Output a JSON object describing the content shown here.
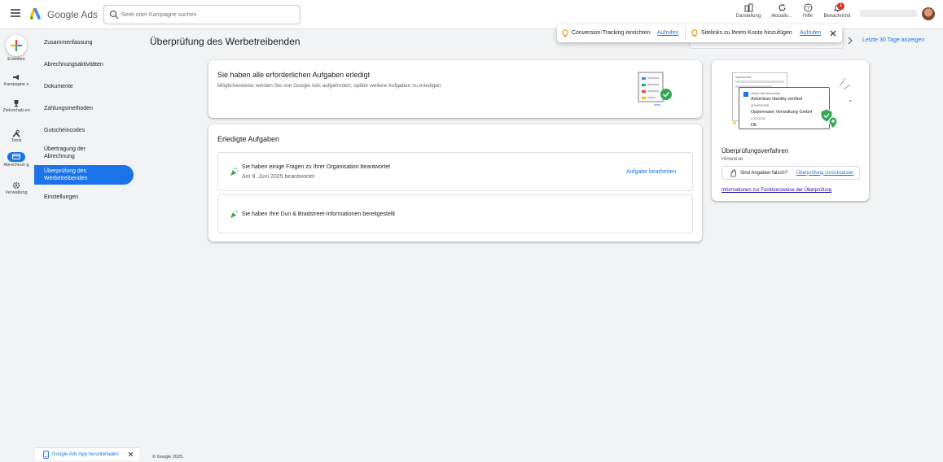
{
  "topbar": {
    "brand": "Google Ads",
    "search_placeholder": "Seite oder Kampagne suchen",
    "tools": [
      {
        "label": "Darstellung"
      },
      {
        "label": "Aktualis..."
      },
      {
        "label": "Hilfe"
      },
      {
        "label": "Benachrichti"
      }
    ],
    "notification_count": "1"
  },
  "rail": {
    "create": "Erstellen",
    "items": [
      "Kampagne n",
      "Zielvorhab en",
      "Tools",
      "Abrechnun g",
      "Verwaltung"
    ]
  },
  "subnav": {
    "items": [
      "Zusammenfassung",
      "Abrechnungsaktivitäten",
      "Dokumente",
      "Zahlungsmethoden",
      "Gutscheincodes",
      "Übertragung der Abrechnung",
      "Überprüfung des Werbetreibenden",
      "Einstellungen"
    ]
  },
  "page": {
    "title": "Überprüfung des Werbetreibenden",
    "date_link": "Letzte 30 Tage anzeigen"
  },
  "notifications": {
    "n1_text": "Conversion-Tracking einrichten",
    "n1_link": "Aufrufen",
    "n2_text": "Sitelinks zu Ihrem Konto hinzufügen",
    "n2_link": "Aufrufen"
  },
  "done_card": {
    "title": "Sie haben alle erforderlichen Aufgaben erledigt",
    "subtitle": "Möglicherweise werden Sie von Google Ads aufgefordert, später weitere Aufgaben zu erledigen"
  },
  "tasks_card": {
    "title": "Erledigte Aufgaben",
    "task1_title": "Sie haben einige Fragen zu Ihrer Organisation beantwortet",
    "task1_date": "Am 9. Juni 2025 beantwortet",
    "task1_action": "Aufgabe bearbeiten",
    "task2_title": "Sie haben Ihre Dun & Bradstreet-Informationen bereitgestellt"
  },
  "side_card": {
    "illus_sponsored": "Sponsored",
    "illus_about": "About this advertiser",
    "illus_verified": "Advertiser identity verified",
    "illus_adv_label": "ADVERTISER",
    "illus_adv_name": "Oppermann Verwaltung GmbH",
    "illus_loc_label": "LOCATION",
    "illus_loc": "DE",
    "title": "Überprüfungsverfahren",
    "subtitle": "Hinweise",
    "wrong_text": "Sind Angaben falsch?",
    "reset_link": "Überprüfung zurücksetzen",
    "info_link": "Informationen zur Funktionsweise der Überprüfung"
  },
  "footer": {
    "app_download": "Google Ads App herunterladen",
    "copyright": "© Google 2025."
  }
}
